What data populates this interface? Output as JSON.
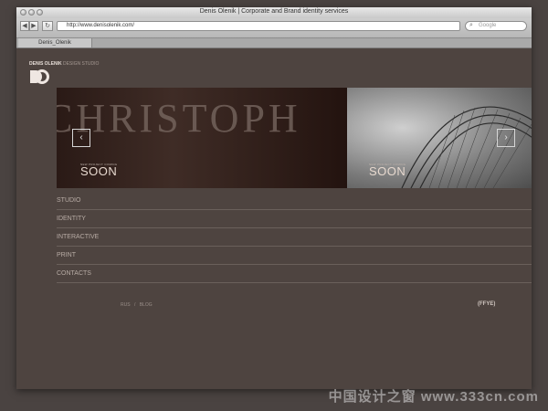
{
  "window": {
    "title": "Denis Olenik | Corporate and Brand identity services"
  },
  "toolbar": {
    "back_label": "◀",
    "forward_label": "▶",
    "reload_label": "↻",
    "url": "http://www.denisolenik.com/",
    "search_placeholder": "Google"
  },
  "tab": {
    "label": "Denis_Olenik"
  },
  "site": {
    "logo_name": "DENIS OLENIK",
    "logo_sub": " DESIGN STUDIO",
    "logo_mark": "DO"
  },
  "slider": {
    "slides": [
      {
        "big_word": "CHRISTOPH",
        "caption": "SOON",
        "small": "NEW PROJECT COMING"
      },
      {
        "caption": "SOON",
        "small": "NEW PROJECT COMING"
      }
    ],
    "prev_label": "‹",
    "next_label": "›"
  },
  "menu": {
    "items": [
      "STUDIO",
      "IDENTITY",
      "INTERACTIVE",
      "PRINT",
      "CONTACTS"
    ]
  },
  "footer": {
    "lang_rus": "RUS",
    "separator": "/",
    "blog": "BLOG",
    "right_text": "(FFYE)"
  },
  "watermark": "中国设计之窗 www.333cn.com"
}
